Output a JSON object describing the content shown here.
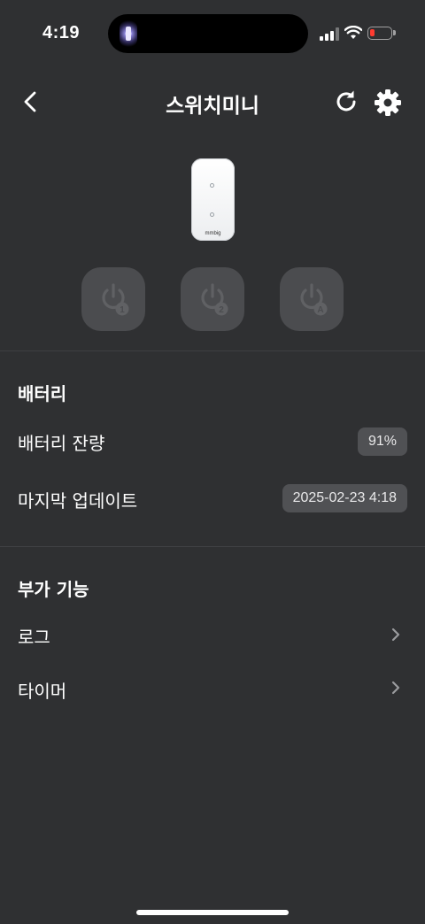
{
  "status_bar": {
    "time": "4:19"
  },
  "header": {
    "title": "스위치미니",
    "back_icon": "chevron-left-icon",
    "refresh_icon": "refresh-icon",
    "settings_icon": "gear-icon"
  },
  "device": {
    "brand": "mmbig"
  },
  "switches": [
    {
      "icon": "power-icon",
      "badge": "1"
    },
    {
      "icon": "power-icon",
      "badge": "2"
    },
    {
      "icon": "power-icon",
      "badge": "A"
    }
  ],
  "battery_section": {
    "title": "배터리",
    "level_label": "배터리 잔량",
    "level_value": "91%",
    "updated_label": "마지막 업데이트",
    "updated_value": "2025-02-23 4:18"
  },
  "extra_section": {
    "title": "부가 기능",
    "items": [
      {
        "label": "로그"
      },
      {
        "label": "타이머"
      }
    ]
  },
  "colors": {
    "background": "#2f3032",
    "button_bg": "#4b4c4f",
    "badge_bg": "#505154",
    "battery_low": "#ff3b30"
  }
}
